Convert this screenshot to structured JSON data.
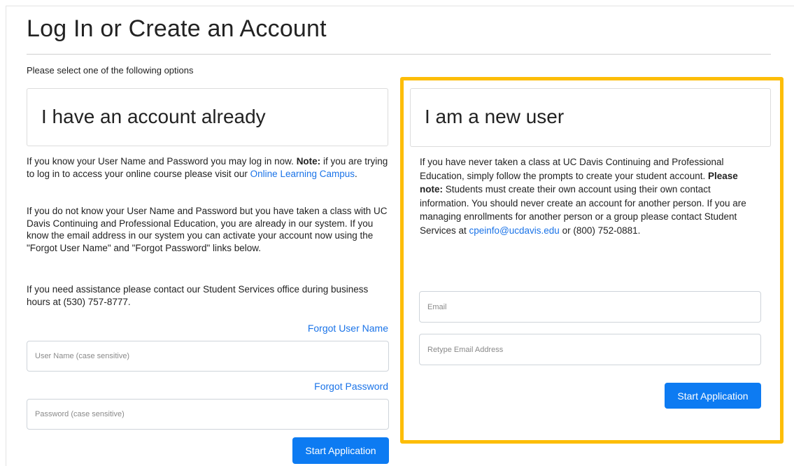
{
  "page": {
    "title": "Log In or Create an Account",
    "intro": "Please select one of the following options"
  },
  "existing": {
    "heading": "I have an account already",
    "p1_text": "If you know your User Name and Password you may log in now. ",
    "p1_note_label": "Note:",
    "p1_after_note": " if you are trying to log in to access your online course please visit our ",
    "p1_link": "Online Learning Campus",
    "p1_end": ".",
    "p2": "If you do not know your User Name and Password but you have taken a class with UC Davis Continuing and Professional Education, you are already in our system. If you know the email address in our system you can activate your account now using the \"Forgot User Name\" and \"Forgot Password\" links below.",
    "p3": "If you need assistance please contact our Student Services office during business hours at (530) 757-8777.",
    "forgot_user": "Forgot User Name",
    "forgot_password": "Forgot Password",
    "username_placeholder": "User Name (case sensitive)",
    "password_placeholder": "Password (case sensitive)",
    "start_button": "Start Application"
  },
  "new_user": {
    "heading": "I am a new user",
    "p1_text": "If you have never taken a class at UC Davis Continuing and Professional Education, simply follow the prompts to create your student account. ",
    "note_label": "Please note:",
    "p1_after_note": " Students must create their own account using their own contact information. You should never create an account for another person.  If you are managing enrollments for another person or a group please contact Student Services at ",
    "email_link": "cpeinfo@ucdavis.edu",
    "p1_end": " or (800) 752-0881.",
    "email_placeholder": "Email",
    "retype_placeholder": "Retype Email Address",
    "start_button": "Start Application"
  },
  "colors": {
    "link": "#1a73e8",
    "button": "#0d7bf2",
    "highlight": "#fdbd07"
  }
}
